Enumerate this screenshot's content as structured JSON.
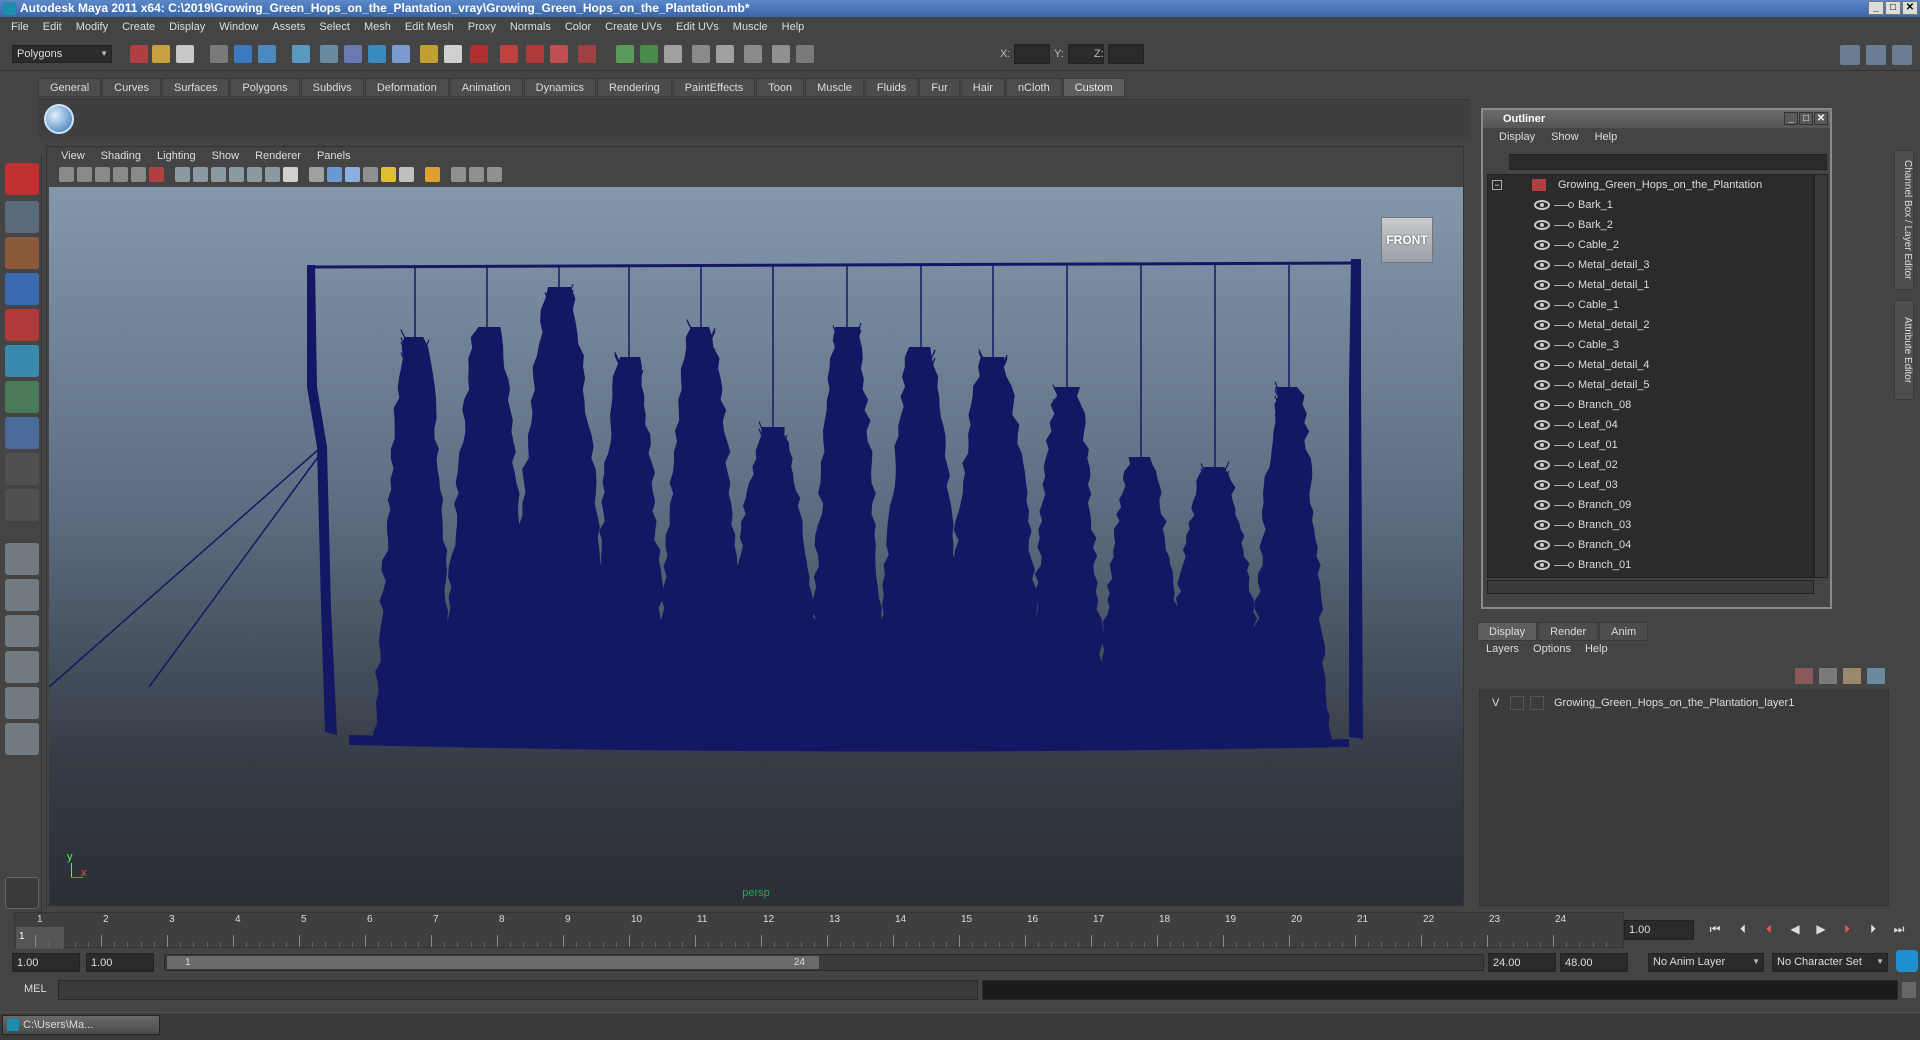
{
  "window": {
    "title": "Autodesk Maya 2011 x64: C:\\2019\\Growing_Green_Hops_on_the_Plantation_vray\\Growing_Green_Hops_on_the_Plantation.mb*",
    "min": "_",
    "max": "□",
    "close": "✕"
  },
  "menu": [
    "File",
    "Edit",
    "Modify",
    "Create",
    "Display",
    "Window",
    "Assets",
    "Select",
    "Mesh",
    "Edit Mesh",
    "Proxy",
    "Normals",
    "Color",
    "Create UVs",
    "Edit UVs",
    "Muscle",
    "Help"
  ],
  "status": {
    "mode": "Polygons",
    "x_label": "X:",
    "y_label": "Y:",
    "z_label": "Z:"
  },
  "shelf": {
    "tabs": [
      "General",
      "Curves",
      "Surfaces",
      "Polygons",
      "Subdivs",
      "Deformation",
      "Animation",
      "Dynamics",
      "Rendering",
      "PaintEffects",
      "Toon",
      "Muscle",
      "Fluids",
      "Fur",
      "Hair",
      "nCloth",
      "Custom"
    ],
    "active_tab": "Custom"
  },
  "panel": {
    "menu": [
      "View",
      "Shading",
      "Lighting",
      "Show",
      "Renderer",
      "Panels"
    ],
    "viewcube": "FRONT",
    "camera": "persp",
    "axis_x": "x",
    "axis_y": "y"
  },
  "outliner": {
    "title": "Outliner",
    "menu": [
      "Display",
      "Show",
      "Help"
    ],
    "root": "Growing_Green_Hops_on_the_Plantation",
    "items": [
      "Bark_1",
      "Bark_2",
      "Cable_2",
      "Metal_detail_3",
      "Metal_detail_1",
      "Cable_1",
      "Metal_detail_2",
      "Cable_3",
      "Metal_detail_4",
      "Metal_detail_5",
      "Branch_08",
      "Leaf_04",
      "Leaf_01",
      "Leaf_02",
      "Leaf_03",
      "Branch_09",
      "Branch_03",
      "Branch_04",
      "Branch_01"
    ]
  },
  "side_tabs": [
    "Channel Box / Layer Editor",
    "Attribute Editor"
  ],
  "layers": {
    "tabs": [
      "Display",
      "Render",
      "Anim"
    ],
    "active_tab": "Display",
    "menu": [
      "Layers",
      "Options",
      "Help"
    ],
    "rows": [
      {
        "v": "V",
        "name": "Growing_Green_Hops_on_the_Plantation_layer1"
      }
    ]
  },
  "timeline": {
    "ticks": [
      "1",
      "2",
      "3",
      "4",
      "5",
      "6",
      "7",
      "8",
      "9",
      "10",
      "11",
      "12",
      "13",
      "14",
      "15",
      "16",
      "17",
      "18",
      "19",
      "20",
      "21",
      "22",
      "23",
      "24"
    ],
    "current": "1",
    "current_field": "1.00"
  },
  "range": {
    "start": "1.00",
    "start2": "1.00",
    "handle_start": "1",
    "handle_end": "24",
    "end": "24.00",
    "end2": "48.00",
    "anim_layer": "No Anim Layer",
    "char_set": "No Character Set"
  },
  "cmd": {
    "label": "MEL"
  },
  "taskbar": {
    "item": "C:\\Users\\Ma..."
  },
  "colors": {
    "mesh": "#141864",
    "accent": "#3a66a8"
  }
}
